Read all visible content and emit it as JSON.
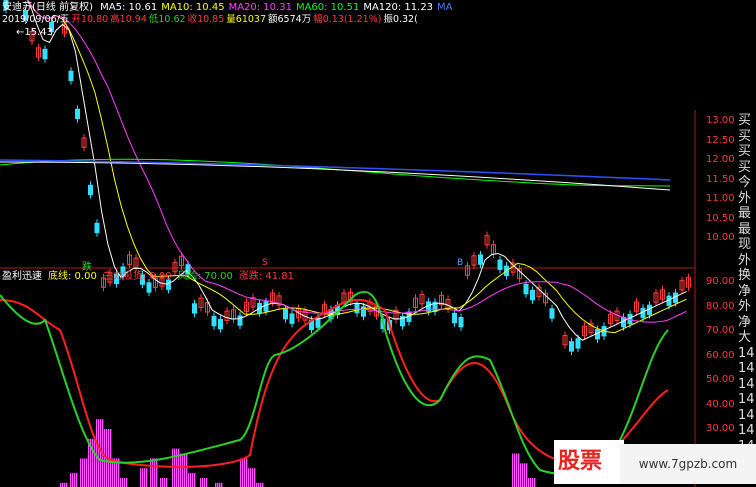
{
  "header": {
    "stock_title": "安迪苏(日线 前复权)",
    "ma": [
      {
        "label": "MA5: 10.61",
        "color": "#ffffff"
      },
      {
        "label": "MA10: 10.45",
        "color": "#ffff00"
      },
      {
        "label": "MA20: 10.31",
        "color": "#ff40ff"
      },
      {
        "label": "MA60: 10.51",
        "color": "#00ff00"
      },
      {
        "label": "MA120: 11.23",
        "color": "#ffffff"
      },
      {
        "label": "MA",
        "color": "#4a7bff"
      }
    ],
    "info": [
      {
        "label": "2019/09/06/五",
        "color": "#ffffff"
      },
      {
        "label": "开10.80",
        "color": "#ff3b3b"
      },
      {
        "label": "高10.94",
        "color": "#ff3b3b"
      },
      {
        "label": "低10.62",
        "color": "#2bd02b"
      },
      {
        "label": "收10.85",
        "color": "#ff3b3b"
      },
      {
        "label": "量61037",
        "color": "#ffff00"
      },
      {
        "label": "额6574万",
        "color": "#ffffff"
      },
      {
        "label": "幅0.13(1.21%)",
        "color": "#ff3b3b"
      },
      {
        "label": "振0.32(",
        "color": "#ffffff"
      }
    ]
  },
  "price_axis": [
    "13.00",
    "12.50",
    "12.00",
    "11.50",
    "11.00",
    "10.50",
    "10.00"
  ],
  "peak_label": "15.43",
  "markers": {
    "die": "跌",
    "s": "S",
    "b": "B"
  },
  "indicator": {
    "labels": [
      {
        "label": "盈利迅速",
        "color": "#ffffff"
      },
      {
        "label": "底线: 0.00",
        "color": "#ffff00"
      },
      {
        "label": "主力吸货: 0.00",
        "color": "#ff3b3b"
      },
      {
        "label": "风险: 70.00",
        "color": "#2bd02b"
      },
      {
        "label": "涨跌: 41.81",
        "color": "#ff3b3b"
      }
    ],
    "axis": [
      "90.00",
      "80.00",
      "70.00",
      "60.00",
      "50.00",
      "40.00",
      "30.00",
      "20.00",
      "10.00"
    ]
  },
  "side_panel": [
    "买",
    "买",
    "买",
    "买",
    "今",
    "外",
    "最",
    "最",
    "现",
    "外",
    "换",
    "净",
    "外",
    "净",
    "大",
    "14",
    "14",
    "14",
    "14",
    "14",
    "14",
    "14",
    "14",
    "14"
  ],
  "watermark": {
    "logo": "股票",
    "url": "www.7gpzb.com"
  }
}
